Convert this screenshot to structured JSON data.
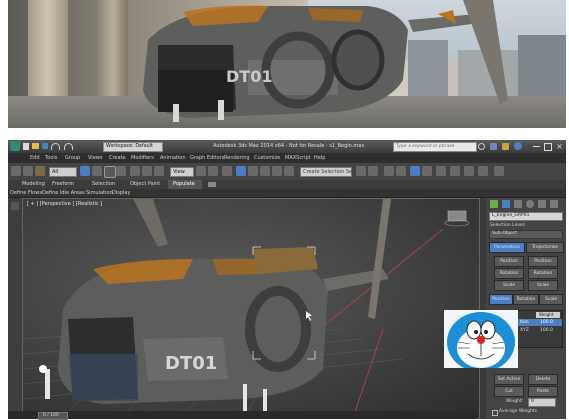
{
  "render": {
    "nose_label": "DT01"
  },
  "app": {
    "workspace": "Workspace: Default",
    "title": "Autodesk 3ds Max 2014 x64   -  Not for Resale  -  s1_Begin.max",
    "search_placeholder": "Type a keyword or phrase",
    "menu": [
      "Edit",
      "Tools",
      "Group",
      "Views",
      "Create",
      "Modifiers",
      "Animation",
      "Graph Editors",
      "Rendering",
      "Customize",
      "MAXScript",
      "Help"
    ],
    "toolbar": {
      "filter": "All",
      "selection_set": "Create Selection Se",
      "view_dropdown": "View"
    },
    "ribbon_tabs": [
      "Modeling",
      "Freeform",
      "Selection",
      "Object Paint",
      "Populate"
    ],
    "ribbon_active": "Populate",
    "ribbon_sub": [
      "Define Flows",
      "Define Idle Areas",
      "Simulation",
      "Display"
    ]
  },
  "viewport": {
    "label": "[ + ] [Perspective ] [Realistic ]",
    "nose_label": "DT01"
  },
  "command_panel": {
    "object_name": "L_Engine_GRP01",
    "selection_level_label": "Selection Level:",
    "selection_level_value": "Sub-Object",
    "tabs": [
      "Parameters",
      "Trajectories"
    ],
    "buttons": [
      "Position",
      "Position",
      "Rotation",
      "Rotation",
      "Scale",
      "Scale"
    ],
    "mode_buttons": [
      "Position",
      "Rotation",
      "Scale"
    ],
    "list_header": "Weight",
    "list_items": [
      {
        "name": "tion",
        "value": "100.0"
      },
      {
        "name": "XYZ",
        "value": "100.0"
      }
    ],
    "bottom_buttons": [
      "Set Active",
      "Delete",
      "Cut",
      "Paste"
    ],
    "weight_label": "Weight:",
    "weight_value": "0",
    "average_label": "Average Weights"
  },
  "status": {
    "frame": "0 / 100"
  },
  "colors": {
    "accent": "#4a7fc4",
    "rust": "#b8741f",
    "grid_red": "#c84848"
  }
}
